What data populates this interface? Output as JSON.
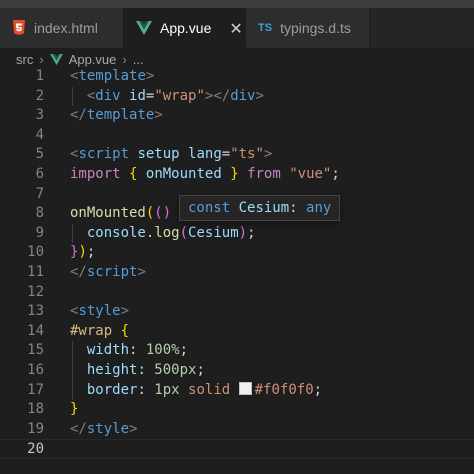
{
  "tabs": [
    {
      "label": "index.html",
      "icon": "html5-icon",
      "active": false
    },
    {
      "label": "App.vue",
      "icon": "vue-icon",
      "active": true,
      "close": "✕"
    },
    {
      "label": "typings.d.ts",
      "icon": "typescript-icon",
      "icon_text": "TS",
      "active": false
    }
  ],
  "breadcrumb": {
    "folder": "src",
    "separator": "›",
    "file": "App.vue",
    "more": "..."
  },
  "hover": {
    "keyword": "const",
    "name": "Cesium",
    "colon": ":",
    "type": "any"
  },
  "colors": {
    "background": "#1e1e1e",
    "tag": "#569cd6",
    "string": "#ce9178",
    "keyword": "#c586c0",
    "function": "#dcdcaa",
    "variable": "#9cdcfe",
    "vue_green": "#41b883",
    "html_orange": "#e44d26"
  },
  "editor": {
    "current_line": 20,
    "lines": [
      {
        "n": "1",
        "tokens": [
          {
            "c": "t-punct",
            "t": "<"
          },
          {
            "c": "t-tag",
            "t": "template"
          },
          {
            "c": "t-punct",
            "t": ">"
          }
        ]
      },
      {
        "n": "2",
        "tokens": [
          {
            "c": "t-txt",
            "t": "  "
          },
          {
            "c": "t-punct",
            "t": "<"
          },
          {
            "c": "t-tag",
            "t": "div"
          },
          {
            "c": "t-txt",
            "t": " "
          },
          {
            "c": "t-attr",
            "t": "id"
          },
          {
            "c": "t-txt",
            "t": "="
          },
          {
            "c": "t-str",
            "t": "\"wrap\""
          },
          {
            "c": "t-punct",
            "t": "></"
          },
          {
            "c": "t-tag",
            "t": "div"
          },
          {
            "c": "t-punct",
            "t": ">"
          }
        ]
      },
      {
        "n": "3",
        "tokens": [
          {
            "c": "t-punct",
            "t": "</"
          },
          {
            "c": "t-tag",
            "t": "template"
          },
          {
            "c": "t-punct",
            "t": ">"
          }
        ]
      },
      {
        "n": "4",
        "tokens": []
      },
      {
        "n": "5",
        "tokens": [
          {
            "c": "t-punct",
            "t": "<"
          },
          {
            "c": "t-tag",
            "t": "script"
          },
          {
            "c": "t-txt",
            "t": " "
          },
          {
            "c": "t-attr",
            "t": "setup"
          },
          {
            "c": "t-txt",
            "t": " "
          },
          {
            "c": "t-attr",
            "t": "lang"
          },
          {
            "c": "t-txt",
            "t": "="
          },
          {
            "c": "t-str",
            "t": "\"ts\""
          },
          {
            "c": "t-punct",
            "t": ">"
          }
        ]
      },
      {
        "n": "6",
        "tokens": [
          {
            "c": "t-kw",
            "t": "import"
          },
          {
            "c": "t-txt",
            "t": " "
          },
          {
            "c": "t-br1",
            "t": "{"
          },
          {
            "c": "t-txt",
            "t": " "
          },
          {
            "c": "t-var",
            "t": "onMounted"
          },
          {
            "c": "t-txt",
            "t": " "
          },
          {
            "c": "t-br1",
            "t": "}"
          },
          {
            "c": "t-txt",
            "t": " "
          },
          {
            "c": "t-kw",
            "t": "from"
          },
          {
            "c": "t-txt",
            "t": " "
          },
          {
            "c": "t-str",
            "t": "\"vue\""
          },
          {
            "c": "t-txt",
            "t": ";"
          }
        ]
      },
      {
        "n": "7",
        "tokens": []
      },
      {
        "n": "8",
        "tokens": [
          {
            "c": "t-fn",
            "t": "onMounted"
          },
          {
            "c": "t-br1",
            "t": "("
          },
          {
            "c": "t-br2",
            "t": "()"
          },
          {
            "c": "t-txt",
            "t": " "
          },
          {
            "c": "t-key",
            "t": "="
          }
        ]
      },
      {
        "n": "9",
        "tokens": [
          {
            "c": "t-txt",
            "t": "  "
          },
          {
            "c": "t-var",
            "t": "console"
          },
          {
            "c": "t-txt",
            "t": "."
          },
          {
            "c": "t-fn",
            "t": "log"
          },
          {
            "c": "t-br2",
            "t": "("
          },
          {
            "c": "t-var",
            "t": "Cesium"
          },
          {
            "c": "t-br2",
            "t": ")"
          },
          {
            "c": "t-txt",
            "t": ";"
          }
        ]
      },
      {
        "n": "10",
        "tokens": [
          {
            "c": "t-br2",
            "t": "}"
          },
          {
            "c": "t-br1",
            "t": ")"
          },
          {
            "c": "t-txt",
            "t": ";"
          }
        ]
      },
      {
        "n": "11",
        "tokens": [
          {
            "c": "t-punct",
            "t": "</"
          },
          {
            "c": "t-tag",
            "t": "script"
          },
          {
            "c": "t-punct",
            "t": ">"
          }
        ]
      },
      {
        "n": "12",
        "tokens": []
      },
      {
        "n": "13",
        "tokens": [
          {
            "c": "t-punct",
            "t": "<"
          },
          {
            "c": "t-tag",
            "t": "style"
          },
          {
            "c": "t-punct",
            "t": ">"
          }
        ]
      },
      {
        "n": "14",
        "tokens": [
          {
            "c": "t-sel",
            "t": "#wrap"
          },
          {
            "c": "t-txt",
            "t": " "
          },
          {
            "c": "t-br1",
            "t": "{"
          }
        ]
      },
      {
        "n": "15",
        "tokens": [
          {
            "c": "t-txt",
            "t": "  "
          },
          {
            "c": "t-prop",
            "t": "width"
          },
          {
            "c": "t-txt",
            "t": ": "
          },
          {
            "c": "t-num",
            "t": "100%"
          },
          {
            "c": "t-txt",
            "t": ";"
          }
        ]
      },
      {
        "n": "16",
        "tokens": [
          {
            "c": "t-txt",
            "t": "  "
          },
          {
            "c": "t-prop",
            "t": "height"
          },
          {
            "c": "t-txt",
            "t": ": "
          },
          {
            "c": "t-num",
            "t": "500px"
          },
          {
            "c": "t-txt",
            "t": ";"
          }
        ]
      },
      {
        "n": "17",
        "tokens": [
          {
            "c": "t-txt",
            "t": "  "
          },
          {
            "c": "t-prop",
            "t": "border"
          },
          {
            "c": "t-txt",
            "t": ": "
          },
          {
            "c": "t-num",
            "t": "1px"
          },
          {
            "c": "t-txt",
            "t": " "
          },
          {
            "c": "t-val",
            "t": "solid"
          },
          {
            "c": "t-txt",
            "t": " "
          },
          {
            "c": "swatch",
            "t": ""
          },
          {
            "c": "t-val",
            "t": "#f0f0f0"
          },
          {
            "c": "t-txt",
            "t": ";"
          }
        ]
      },
      {
        "n": "18",
        "tokens": [
          {
            "c": "t-br1",
            "t": "}"
          }
        ]
      },
      {
        "n": "19",
        "tokens": [
          {
            "c": "t-punct",
            "t": "</"
          },
          {
            "c": "t-tag",
            "t": "style"
          },
          {
            "c": "t-punct",
            "t": ">"
          }
        ]
      },
      {
        "n": "20",
        "tokens": []
      }
    ]
  }
}
